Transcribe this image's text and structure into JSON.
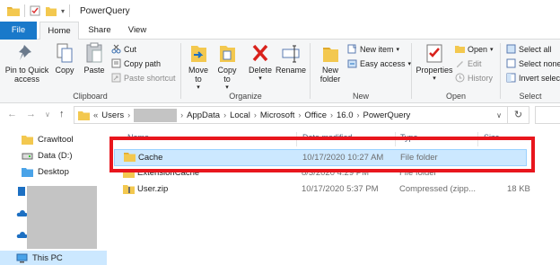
{
  "window": {
    "title": "PowerQuery"
  },
  "tabs": [
    {
      "label": "File"
    },
    {
      "label": "Home"
    },
    {
      "label": "Share"
    },
    {
      "label": "View"
    }
  ],
  "ribbon": {
    "clipboard": {
      "label": "Clipboard",
      "pin": "Pin to Quick access",
      "copy": "Copy",
      "paste": "Paste",
      "cut": "Cut",
      "copy_path": "Copy path",
      "paste_shortcut": "Paste shortcut"
    },
    "organize": {
      "label": "Organize",
      "move_to": "Move to",
      "copy_to": "Copy to",
      "delete": "Delete",
      "rename": "Rename"
    },
    "new": {
      "label": "New",
      "new_folder": "New folder",
      "new_item": "New item",
      "easy_access": "Easy access"
    },
    "open": {
      "label": "Open",
      "properties": "Properties",
      "open": "Open",
      "edit": "Edit",
      "history": "History"
    },
    "select": {
      "label": "Select",
      "select_all": "Select all",
      "select_none": "Select none",
      "invert": "Invert selection"
    }
  },
  "address": {
    "prefix": "«",
    "crumbs": [
      "Users",
      "AppData",
      "Local",
      "Microsoft",
      "Office",
      "16.0",
      "PowerQuery"
    ]
  },
  "nav": {
    "items": [
      {
        "label": "Crawltool"
      },
      {
        "label": "Data (D:)"
      },
      {
        "label": "Desktop"
      },
      {
        "label": "This PC"
      }
    ]
  },
  "columns": [
    "Name",
    "Date modified",
    "Type",
    "Size"
  ],
  "files": [
    {
      "name": "Cache",
      "date": "10/17/2020 10:27 AM",
      "type": "File folder",
      "size": ""
    },
    {
      "name": "ExtensionCache",
      "date": "8/3/2020 4:29 PM",
      "type": "File folder",
      "size": ""
    },
    {
      "name": "User.zip",
      "date": "10/17/2020 5:37 PM",
      "type": "Compressed (zipp...",
      "size": "18 KB"
    }
  ],
  "colors": {
    "file_tab": "#1979ca",
    "selection": "#cce8ff",
    "highlight": "#e8161d",
    "folder": "#f3c84f"
  }
}
